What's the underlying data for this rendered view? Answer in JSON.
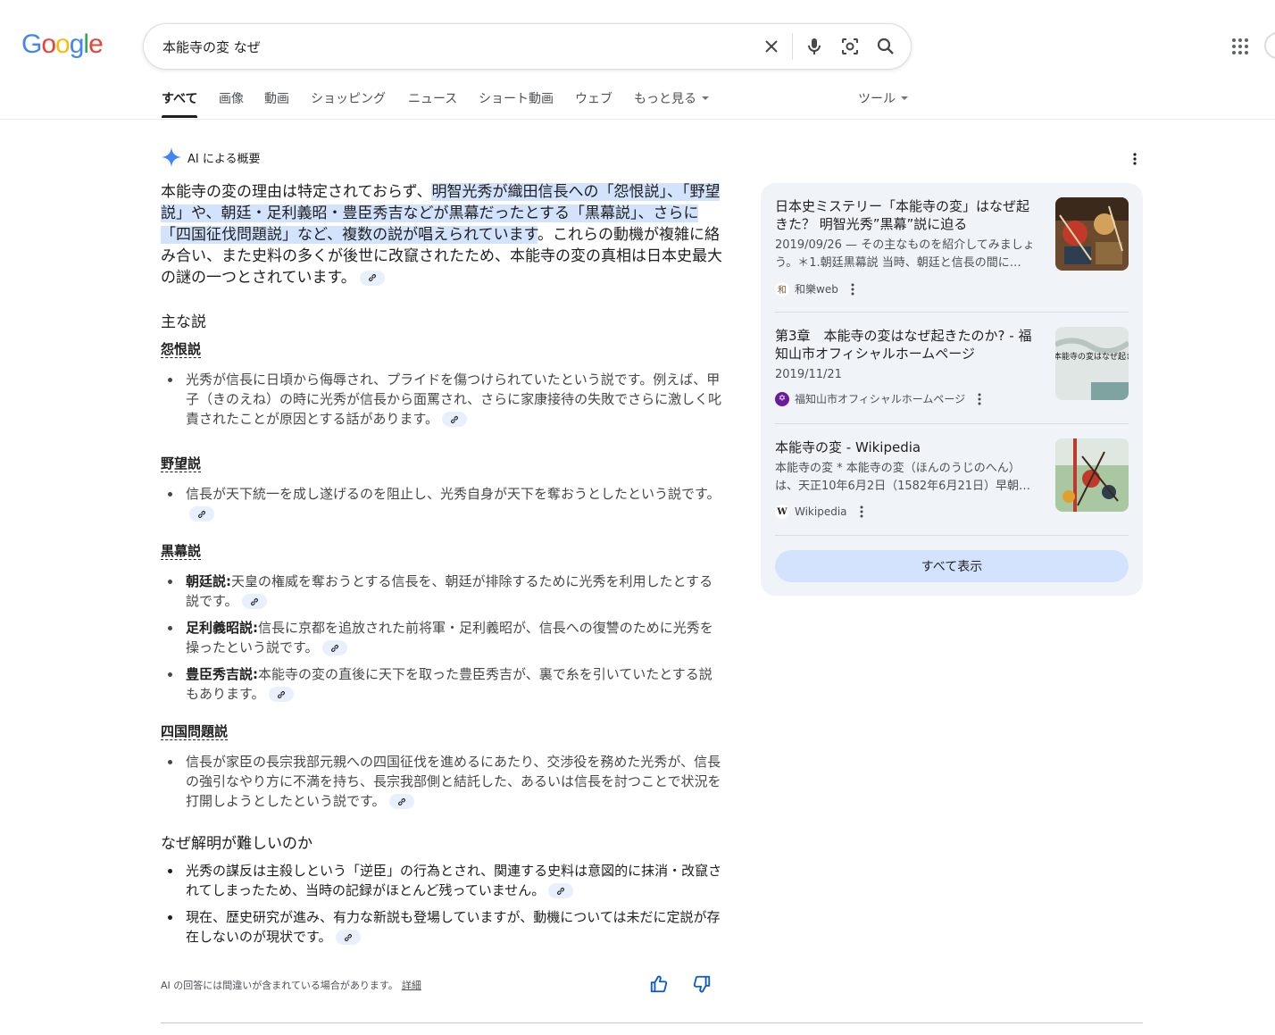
{
  "logo": "Google",
  "search": {
    "query": "本能寺の変 なぜ"
  },
  "tabs": [
    {
      "label": "すべて"
    },
    {
      "label": "画像"
    },
    {
      "label": "動画"
    },
    {
      "label": "ショッピング"
    },
    {
      "label": "ニュース"
    },
    {
      "label": "ショート動画"
    },
    {
      "label": "ウェブ"
    },
    {
      "label": "もっと見る"
    }
  ],
  "tools_label": "ツール",
  "ai": {
    "header": "AI による概要",
    "summary_plain_1": "本能寺の変の理由は特定されておらず、",
    "summary_highlight": "明智光秀が織田信長への「怨恨説」、「野望説」や、朝廷・足利義昭・豊臣秀吉などが黒幕だったとする「黒幕説」、さらに「四国征伐問題説」など、複数の説が唱えられています",
    "summary_plain_2": "。これらの動機が複雑に絡み合い、また史料の多くが後世に改竄されたため、本能寺の変の真相は日本史最大の謎の一つとされています。",
    "main_heading": "主な説",
    "theory1_title": "怨恨説",
    "theory1_bullet": "光秀が信長に日頃から侮辱され、プライドを傷つけられていたという説です。例えば、甲子（きのえね）の時に光秀が信長から面罵され、さらに家康接待の失敗でさらに激しく叱責されたことが原因とする話があります。",
    "theory2_title": "野望説",
    "theory2_bullet": "信長が天下統一を成し遂げるのを阻止し、光秀自身が天下を奪おうとしたという説です。",
    "theory3_title": "黒幕説",
    "theory3_items": [
      {
        "term": "朝廷説:",
        "text": "天皇の権威を奪おうとする信長を、朝廷が排除するために光秀を利用したとする説です。"
      },
      {
        "term": "足利義昭説:",
        "text": "信長に京都を追放された前将軍・足利義昭が、信長への復讐のために光秀を操ったという説です。"
      },
      {
        "term": "豊臣秀吉説:",
        "text": "本能寺の変の直後に天下を取った豊臣秀吉が、裏で糸を引いていたとする説もあります。"
      }
    ],
    "theory4_title": "四国問題説",
    "theory4_bullet": "信長が家臣の長宗我部元親への四国征伐を進めるにあたり、交渉役を務めた光秀が、信長の強引なやり方に不満を持ち、長宗我部側と結託した、あるいは信長を討つことで状況を打開しようとしたという説です。",
    "why_heading": "なぜ解明が難しいのか",
    "why_bullets": [
      "光秀の謀反は主殺しという「逆臣」の行為とされ、関連する史料は意図的に抹消・改竄されてしまったため、当時の記録がほとんど残っていません。",
      "現在、歴史研究が進み、有力な新説も登場していますが、動機については未だに定説が存在しないのが現状です。"
    ],
    "disclaimer": "AI の回答には間違いが含まれている場合があります。",
    "details_link": "詳細"
  },
  "sources": [
    {
      "title": "日本史ミステリー「本能寺の変」はなぜ起きた？ 明智光秀”黒幕”説に迫る",
      "snippet": "2019/09/26 — その主なものを紹介してみましょう。＊1.朝廷黒幕説 当時、朝廷と信長の間に…",
      "source": "和樂web",
      "favicon_char": "和"
    },
    {
      "title": "第3章　本能寺の変はなぜ起きたのか? - 福知山市オフィシャルホームページ",
      "snippet": "2019/11/21",
      "source": "福知山市オフィシャルホームページ",
      "favicon_char": "✡",
      "image_text": "本能寺の変はなぜ起きたのか？"
    },
    {
      "title": "本能寺の変 - Wikipedia",
      "snippet": "本能寺の変 * 本能寺の変（ほんのうじのへん）は、天正10年6月2日（1582年6月21日）早朝…",
      "source": "Wikipedia",
      "favicon_char": "W"
    }
  ],
  "show_all": "すべて表示"
}
